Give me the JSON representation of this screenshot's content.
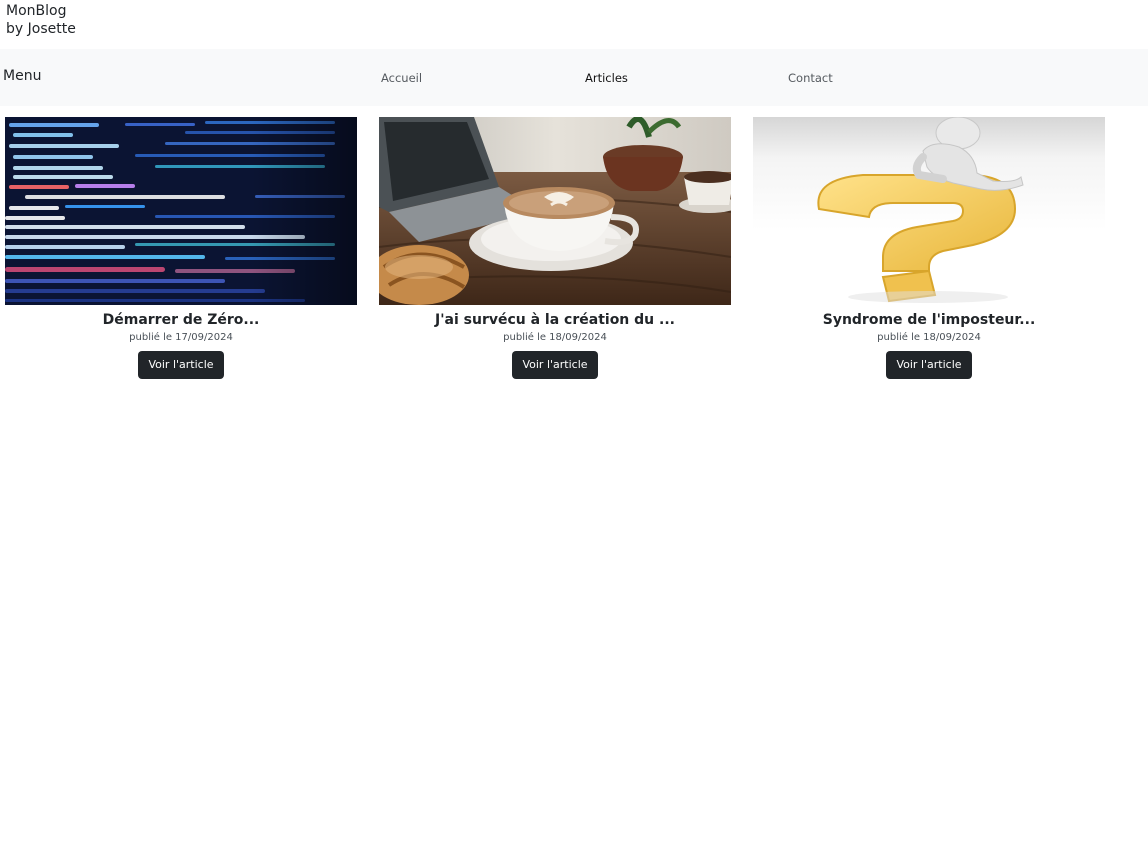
{
  "brand": {
    "line1": "MonBlog",
    "line2": "by Josette"
  },
  "navbar": {
    "menu_label": "Menu",
    "links": [
      {
        "label": "Accueil"
      },
      {
        "label": "Articles"
      },
      {
        "label": "Contact"
      }
    ]
  },
  "articles": [
    {
      "title": "Démarrer de Zéro...",
      "date": "publié le 17/09/2024",
      "button": "Voir l'article",
      "image": "code-screen-image"
    },
    {
      "title": "J'ai survécu à la création du ...",
      "date": "publié le 18/09/2024",
      "button": "Voir l'article",
      "image": "coffee-cup-image"
    },
    {
      "title": "Syndrome de l'imposteur...",
      "date": "publié le 18/09/2024",
      "button": "Voir l'article",
      "image": "question-mark-image"
    }
  ],
  "colors": {
    "navbar_bg": "#f8f9fa",
    "button_bg": "#212529",
    "text": "#212529"
  }
}
